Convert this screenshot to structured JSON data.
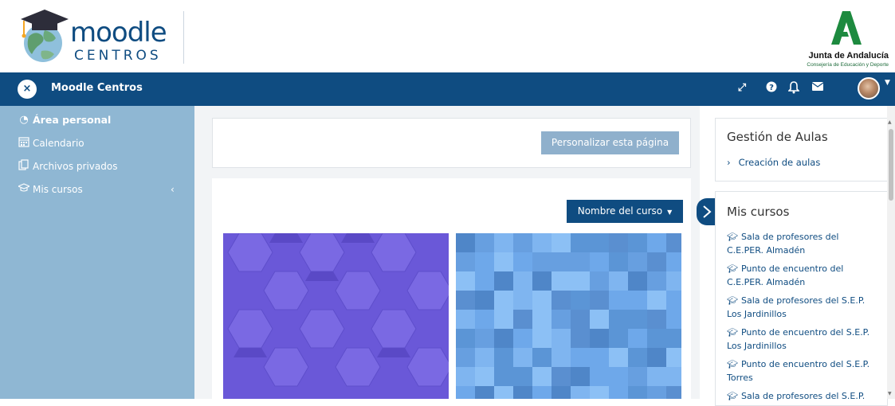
{
  "brand": {
    "logo_word": "moodle",
    "logo_sub": "CENTROS",
    "junta_name": "Junta de Andalucía",
    "junta_sub": "Consejería de Educación y Deporte"
  },
  "navbar": {
    "site_name": "Moodle Centros",
    "toggle_symbol": "×",
    "icons": [
      "fullscreen-icon",
      "help-icon",
      "bell-icon",
      "envelope-icon",
      "avatar"
    ]
  },
  "sidebar": {
    "items": [
      {
        "label": "Área personal",
        "icon": "dashboard-icon",
        "active": true
      },
      {
        "label": "Calendario",
        "icon": "calendar-icon"
      },
      {
        "label": "Archivos privados",
        "icon": "files-icon"
      },
      {
        "label": "Mis cursos",
        "icon": "graduation-cap-icon"
      }
    ]
  },
  "main": {
    "customize_button": "Personalizar esta página",
    "sort_button": "Nombre del curso"
  },
  "blocks": {
    "aulas": {
      "title": "Gestión de Aulas",
      "link": "Creación de aulas"
    },
    "mis_cursos": {
      "title": "Mis cursos",
      "courses": [
        "Sala de profesores del C.E.PER. Almadén",
        "Punto de encuentro del C.E.PER. Almadén",
        "Sala de profesores del S.E.P. Los Jardinillos",
        "Punto de encuentro del S.E.P. Los Jardinillos",
        "Punto de encuentro del S.E.P. Torres",
        "Sala de profesores del S.E.P."
      ]
    }
  },
  "colors": {
    "navbar": "#0f4c81",
    "sidebar": "#8fb7d3",
    "link": "#0f4c81",
    "course1": "#6a58d8",
    "course2": "#6ea8ea"
  }
}
